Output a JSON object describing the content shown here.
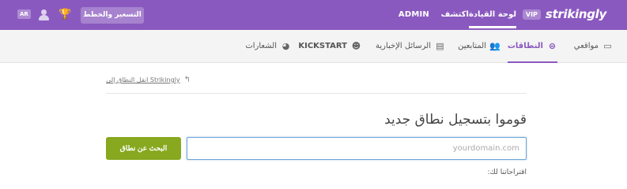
{
  "topbar": {
    "logo": "strikingly",
    "vip_badge": "VIP",
    "nav": {
      "dashboard": "لوحة القيادة",
      "explore": "اكتشف",
      "admin": "ADMIN"
    },
    "pricing_button": "التسعير والخطط",
    "language": "AR",
    "colors": {
      "bar": "#8a59bf",
      "trophy": "#f3d23a"
    }
  },
  "subnav": {
    "tabs": [
      {
        "label": "مواقعي",
        "icon": "window-icon",
        "glyph": "▭"
      },
      {
        "label": "النطاقات",
        "icon": "globe-icon",
        "glyph": "⊜",
        "active": true
      },
      {
        "label": "المتابعين",
        "icon": "users-icon",
        "glyph": "👥"
      },
      {
        "label": "الرسائل الإخبارية",
        "icon": "newsletter-icon",
        "glyph": "▤"
      },
      {
        "label": "KICKSTART",
        "icon": "smiley-icon",
        "glyph": "☻"
      },
      {
        "label": "الشعارات",
        "icon": "palette-icon",
        "glyph": "◕"
      }
    ]
  },
  "breadcrumb": {
    "back_glyph": "↰",
    "text": "Strikingly انقل النطاق إلى"
  },
  "main": {
    "heading": "قوموا بتسجيل نطاق جديد",
    "domain_input": {
      "value": "",
      "placeholder": "yourdomain.com"
    },
    "search_button": "البحث عن نطاق",
    "search_button_color": "#87a81f",
    "suggestions_label": "اقتراحاتنا لك:"
  }
}
